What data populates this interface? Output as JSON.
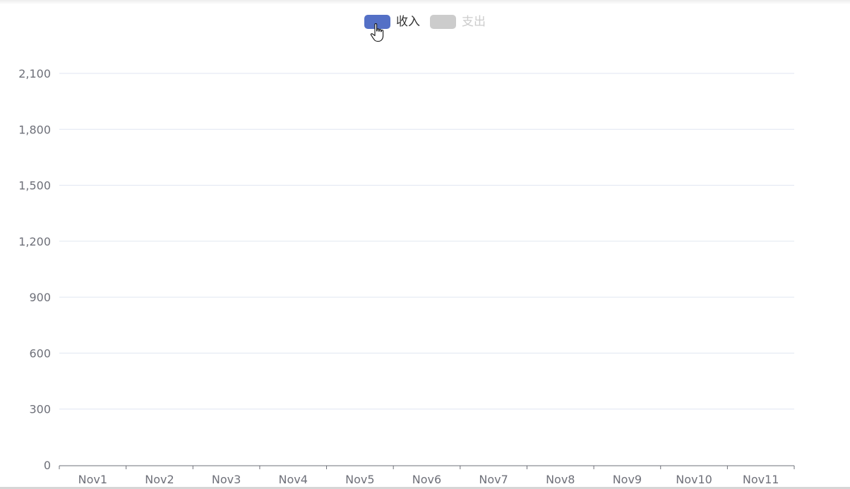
{
  "chart_data": {
    "type": "bar",
    "categories": [
      "Nov1",
      "Nov2",
      "Nov3",
      "Nov4",
      "Nov5",
      "Nov6",
      "Nov7",
      "Nov8",
      "Nov9",
      "Nov10",
      "Nov11"
    ],
    "series": [
      {
        "name": "收入",
        "values": [],
        "visible": true,
        "color": "#5470c6"
      },
      {
        "name": "支出",
        "values": [],
        "visible": false,
        "color": "#cccccc"
      }
    ],
    "y_ticks": [
      "0",
      "300",
      "600",
      "900",
      "1,200",
      "1,500",
      "1,800",
      "2,100"
    ],
    "ylim": [
      0,
      2100
    ],
    "grid": true,
    "legend_position": "top-center"
  },
  "legend": {
    "items": [
      {
        "label": "收入",
        "color": "#5470c6",
        "text_color": "#333333"
      },
      {
        "label": "支出",
        "color": "#cccccc",
        "text_color": "#cccccc"
      }
    ]
  },
  "icons": {
    "cursor": "hand-pointer-icon"
  },
  "colors": {
    "grid": "#e0e6f1",
    "axis": "#6e7079"
  }
}
